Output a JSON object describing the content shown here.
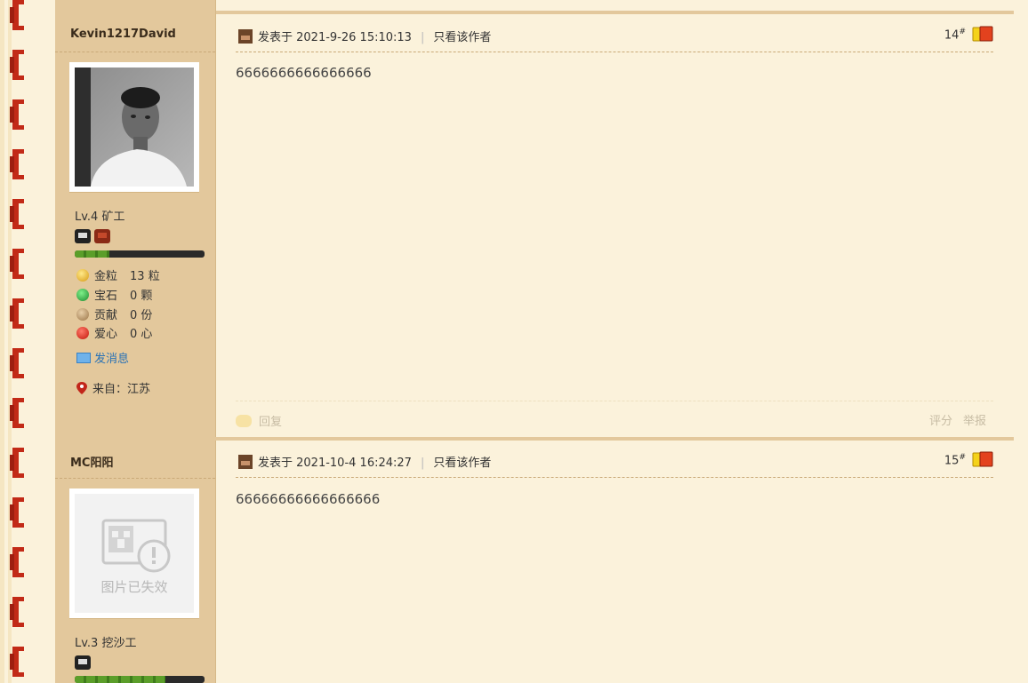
{
  "posts": [
    {
      "author": "Kevin1217David",
      "level": "Lv.4 矿工",
      "stats": [
        {
          "icon": "gold-nugget-icon",
          "label": "金粒",
          "value": "13 粒"
        },
        {
          "icon": "gem-icon",
          "label": "宝石",
          "value": "0 颗"
        },
        {
          "icon": "contribution-icon",
          "label": "贡献",
          "value": "0 份"
        },
        {
          "icon": "heart-icon",
          "label": "爱心",
          "value": "0 心"
        }
      ],
      "send_message": "发消息",
      "from": "来自：江苏",
      "posted": "发表于 2021-9-26 15:10:13",
      "only_author": "只看该作者",
      "floor": "14",
      "floor_mark": "#",
      "content": "6666666666666666",
      "reply": "回复",
      "rate": "评分",
      "report": "举报",
      "xp_progress": 0.27
    },
    {
      "author": "MC阳阳",
      "level": "Lv.3 挖沙工",
      "avatar_broken_text": "图片已失效",
      "posted": "发表于 2021-10-4 16:24:27",
      "only_author": "只看该作者",
      "floor": "15",
      "floor_mark": "#",
      "content": "66666666666666666",
      "xp_progress": 0.7
    }
  ],
  "pipe": "|",
  "colors": {
    "sidebar_bg": "#e3c89c",
    "page_bg": "#fbf2db",
    "link_blue": "#2a72b5"
  }
}
